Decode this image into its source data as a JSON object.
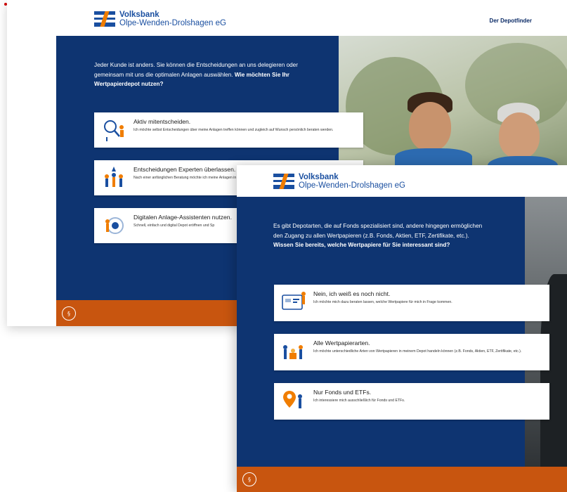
{
  "colors": {
    "brand_blue": "#0e3471",
    "logo_blue": "#1a4fa0",
    "logo_orange": "#f07d00",
    "footer_orange": "#c8550f"
  },
  "back_screen": {
    "logo": {
      "line1": "Volksbank",
      "line2": "Olpe-Wenden-Drolshagen eG"
    },
    "nav_link": "Der Depotfinder",
    "intro_text": "Jeder Kunde ist anders. Sie können die Entscheidungen an uns delegieren oder gemeinsam mit uns die optimalen Anlagen auswählen.",
    "intro_question": "Wie möchten Sie Ihr Wertpapierdepot nutzen?",
    "options": [
      {
        "icon": "magnifier-person-icon",
        "title": "Aktiv mitentscheiden.",
        "description": "Ich möchte selbst Entscheidungen über meine Anlagen treffen können und zugleich auf Wunsch persönlich beraten werden."
      },
      {
        "icon": "experts-team-icon",
        "title": "Entscheidungen Experten überlassen.",
        "description": "Nach einer anfänglichen Beratung möchte ich meine Anlagen in den Händen wissen und mich nicht mehr selbst um mein"
      },
      {
        "icon": "digital-assistant-icon",
        "title": "Digitalen Anlage-Assistenten nutzen.",
        "description": "Schnell, einfach und digital Depot eröffnen und Sp"
      }
    ],
    "footer_icon": "§"
  },
  "front_screen": {
    "logo": {
      "line1": "Volksbank",
      "line2": "Olpe-Wenden-Drolshagen eG"
    },
    "intro_text": "Es gibt Depotarten, die auf Fonds spezialisiert sind, andere hingegen ermöglichen den Zugang zu allen Wertpapieren (z.B. Fonds, Aktien, ETF, Zertifikate, etc.).",
    "intro_question": "Wissen Sie bereits, welche Wertpapiere für Sie interessant sind?",
    "options": [
      {
        "icon": "dashboard-screen-icon",
        "title": "Nein, ich weiß es noch nicht.",
        "description": "Ich möchte mich dazu beraten lassen, welche Wertpapiere für mich in Frage kommen."
      },
      {
        "icon": "people-coins-icon",
        "title": "Alle Wertpapierarten.",
        "description": "Ich möchte unterschiedliche Arten von Wertpapieren in meinem Depot handeln können (z.B. Fonds, Aktien, ETF, Zertifikate, etc.)."
      },
      {
        "icon": "location-pin-people-icon",
        "title": "Nur Fonds und ETFs.",
        "description": "Ich interessiere mich ausschließlich für Fonds und ETFs."
      }
    ],
    "footer_icon": "§"
  }
}
